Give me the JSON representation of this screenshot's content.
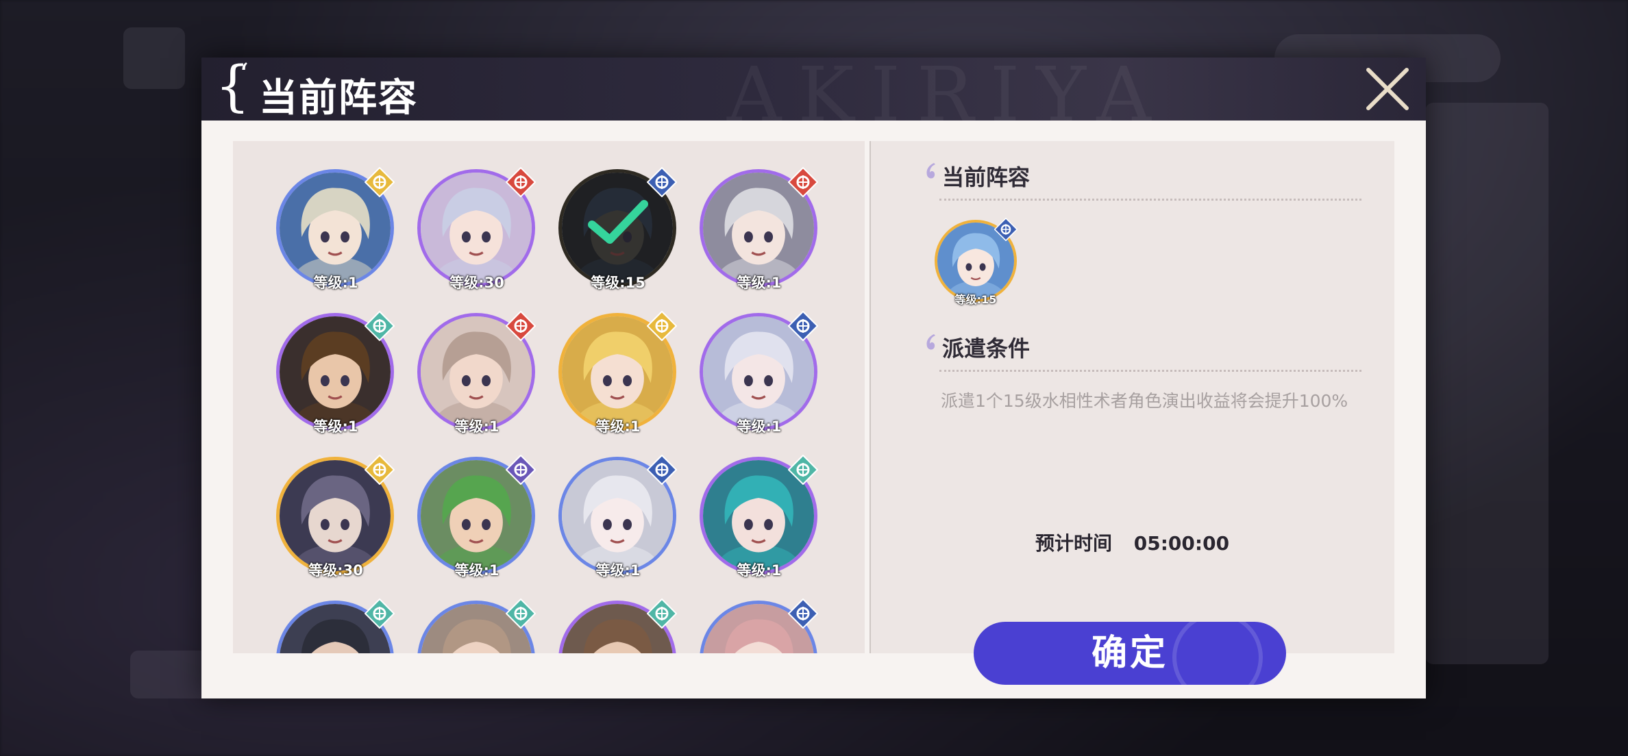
{
  "dialog": {
    "title": "当前阵容",
    "watermark": "AKIRIYA"
  },
  "characters": [
    {
      "level": "等级:1",
      "rarity": "blue",
      "element": "gold",
      "hair": "#d7d4c3",
      "skin": "#f3e3d6",
      "bg": "#4a6fa8"
    },
    {
      "level": "等级:30",
      "rarity": "purple",
      "element": "red",
      "hair": "#c9cde4",
      "skin": "#f6e2da",
      "bg": "#c9b9d9"
    },
    {
      "level": "等级:15",
      "rarity": "dark",
      "element": "blue",
      "hair": "#3b4b63",
      "skin": "#5b5a52",
      "bg": "#2d3036",
      "selected": true
    },
    {
      "level": "等级:1",
      "rarity": "purple",
      "element": "red",
      "hair": "#d6d6dc",
      "skin": "#f3e4de",
      "bg": "#8e8c9e"
    },
    {
      "level": "等级:1",
      "rarity": "purple",
      "element": "teal",
      "hair": "#5b3d22",
      "skin": "#e9c6a9",
      "bg": "#3a2f2d"
    },
    {
      "level": "等级:1",
      "rarity": "purple",
      "element": "red",
      "hair": "#b69f94",
      "skin": "#f1d8cb",
      "bg": "#d7c5be"
    },
    {
      "level": "等级:1",
      "rarity": "gold",
      "element": "gold",
      "hair": "#f0cf6a",
      "skin": "#f5dfd2",
      "bg": "#d8ac4a"
    },
    {
      "level": "等级:1",
      "rarity": "purple",
      "element": "blue",
      "hair": "#e0e1ee",
      "skin": "#f4e6e6",
      "bg": "#b7bcd8"
    },
    {
      "level": "等级:30",
      "rarity": "gold",
      "element": "gold",
      "hair": "#6a6582",
      "skin": "#e7d7cf",
      "bg": "#3c3a52"
    },
    {
      "level": "等级:1",
      "rarity": "blue",
      "element": "purple",
      "hair": "#56a54f",
      "skin": "#efd0b7",
      "bg": "#6b8d62"
    },
    {
      "level": "等级:1",
      "rarity": "blue",
      "element": "blue",
      "hair": "#e7e7ee",
      "skin": "#f7ebeb",
      "bg": "#c8c9d6"
    },
    {
      "level": "等级:1",
      "rarity": "purple",
      "element": "teal",
      "hair": "#32b0b5",
      "skin": "#f3e0dc",
      "bg": "#2f7f8f"
    },
    {
      "level": "",
      "rarity": "blue",
      "element": "teal",
      "hair": "#2c2e3a",
      "skin": "#e5c9b8",
      "bg": "#3d3f52"
    },
    {
      "level": "",
      "rarity": "blue",
      "element": "teal",
      "hair": "#b19784",
      "skin": "#eed3c3",
      "bg": "#9d8b80"
    },
    {
      "level": "",
      "rarity": "purple",
      "element": "teal",
      "hair": "#7a5a44",
      "skin": "#e8c9b3",
      "bg": "#6e5a4e"
    },
    {
      "level": "",
      "rarity": "blue",
      "element": "blue",
      "hair": "#d9a4a6",
      "skin": "#f3ddd6",
      "bg": "#c79da0"
    }
  ],
  "sidebar": {
    "team_title": "当前阵容",
    "team_member": {
      "level": "等级:15",
      "hair": "#8fbbe9",
      "skin": "#f8e7df",
      "bg": "#5f8fcd"
    },
    "condition_title": "派遣条件",
    "condition_text": "派遣1个15级水相性术者角色演出收益将会提升100%",
    "eta_label": "预计时间",
    "eta_value": "05:00:00",
    "confirm_label": "确定"
  },
  "colors": {
    "accent": "#4a40d2",
    "rarity_blue": "#6b86e6",
    "rarity_purple": "#a16bea",
    "rarity_gold": "#f0b23c",
    "rarity_dark": "#2e2a22",
    "element_gold": "#e7b93c",
    "element_red": "#d8493e",
    "element_blue": "#3c5fb3",
    "element_teal": "#4fb6a6",
    "element_purple": "#6a57b8",
    "check": "#35d49c"
  }
}
